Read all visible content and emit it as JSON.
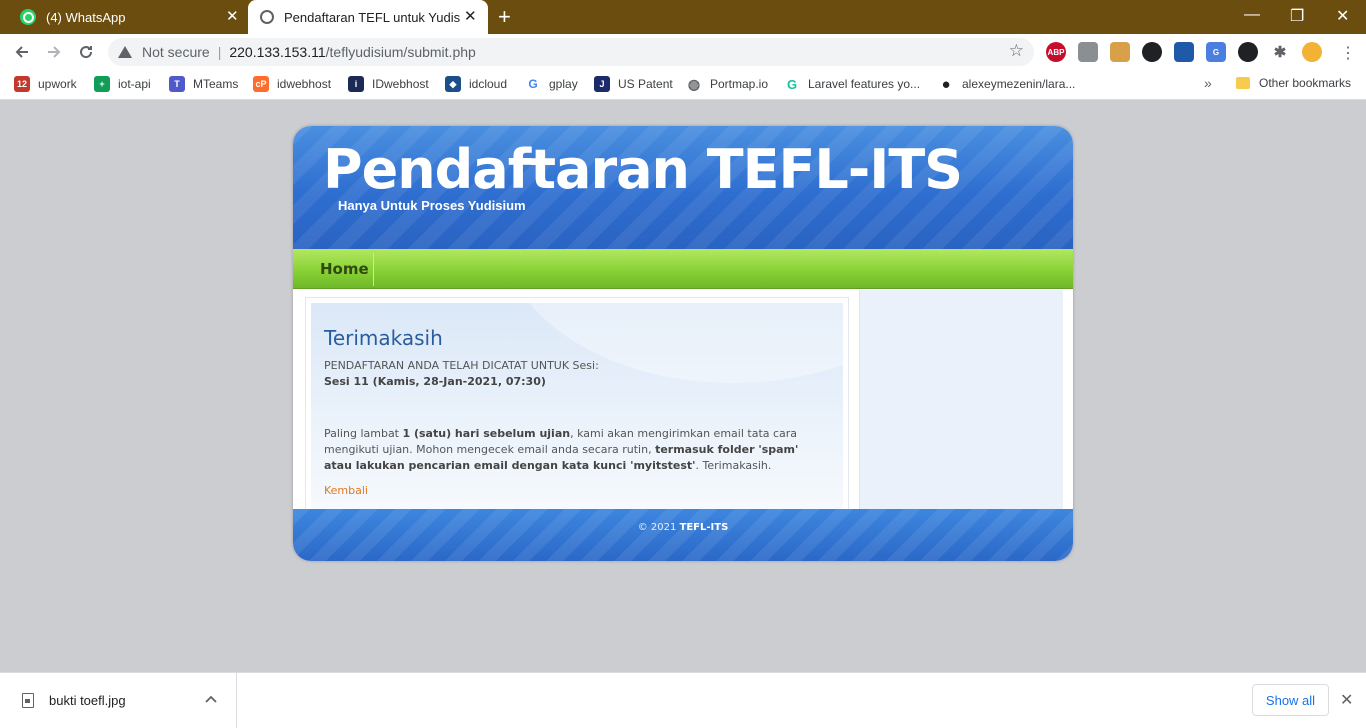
{
  "browser": {
    "tabs": [
      {
        "title": "(4) WhatsApp",
        "icon": "whatsapp-icon"
      },
      {
        "title": "Pendaftaran TEFL untuk Yudisium",
        "icon": "globe-icon"
      }
    ],
    "new_tab_symbol": "+",
    "window_controls": {
      "minimize": "—",
      "restore": "❐",
      "close": "✕"
    },
    "security_label": "Not secure",
    "url_host": "220.133.153.11",
    "url_path": "/teflyudisium/submit.php",
    "extensions": [
      {
        "label": "ABP",
        "color": "#c70d2c"
      },
      {
        "label": "",
        "color": "#8a8f94"
      },
      {
        "label": "",
        "color": "#d9a04a"
      },
      {
        "label": "",
        "color": "#202124"
      },
      {
        "label": "",
        "color": "#1f5aa8"
      },
      {
        "label": "G",
        "color": "#4a7fe0"
      },
      {
        "label": "",
        "color": "#202124"
      },
      {
        "label": "",
        "color": "#5f6368"
      },
      {
        "label": "",
        "color": "#f2b233"
      }
    ],
    "bookmarks": [
      {
        "label": "upwork",
        "icon": "calendar-icon",
        "color": "#c0392b",
        "glyph": "12"
      },
      {
        "label": "iot-api",
        "icon": "sheets-icon",
        "color": "#0f9d58",
        "glyph": "+"
      },
      {
        "label": "MTeams",
        "icon": "teams-icon",
        "color": "#5059c9",
        "glyph": "T"
      },
      {
        "label": "idwebhost",
        "icon": "cpanel-icon",
        "color": "#ff6c2c",
        "glyph": "cP"
      },
      {
        "label": "IDwebhost",
        "icon": "idwebhost-icon",
        "color": "#1b2a57",
        "glyph": "i"
      },
      {
        "label": "idcloud",
        "icon": "idcloud-icon",
        "color": "#1b4f8a",
        "glyph": "◆"
      },
      {
        "label": "gplay",
        "icon": "google-icon",
        "color": "#ffffff",
        "glyph": "G"
      },
      {
        "label": "US Patent",
        "icon": "justia-icon",
        "color": "#1b2a6b",
        "glyph": "J"
      },
      {
        "label": "Portmap.io",
        "icon": "globe-icon",
        "color": "#5f6368",
        "glyph": "◍"
      },
      {
        "label": "Laravel features yo...",
        "icon": "grammarly-icon",
        "color": "#15c39a",
        "glyph": "G"
      },
      {
        "label": "alexeymezenin/lara...",
        "icon": "github-icon",
        "color": "#202124",
        "glyph": "●"
      }
    ],
    "bookmarks_more": "»",
    "other_bookmarks": "Other bookmarks"
  },
  "site": {
    "title": "Pendaftaran TEFL-ITS",
    "subtitle": "Hanya Untuk Proses Yudisium",
    "nav": {
      "home": "Home"
    },
    "post": {
      "title": "Terimakasih",
      "line1": "PENDAFTARAN ANDA TELAH DICATAT UNTUK Sesi:",
      "session": "Sesi 11 (Kamis, 28-Jan-2021, 07:30)",
      "para": {
        "t1": "Paling lambat ",
        "b1": "1 (satu) hari sebelum ujian",
        "t2": ", kami akan mengirimkan email tata cara mengikuti ujian. Mohon mengecek email anda secara rutin, ",
        "b2": "termasuk folder 'spam' atau lakukan pencarian email dengan kata kunci 'myitstest'",
        "t3": ". Terimakasih."
      },
      "back_link": "Kembali"
    },
    "footer": {
      "prefix": "© 2021 ",
      "brand": "TEFL-ITS"
    }
  },
  "download_bar": {
    "filename": "bukti toefl.jpg",
    "caret": "^",
    "show_all": "Show all",
    "close": "✕"
  }
}
